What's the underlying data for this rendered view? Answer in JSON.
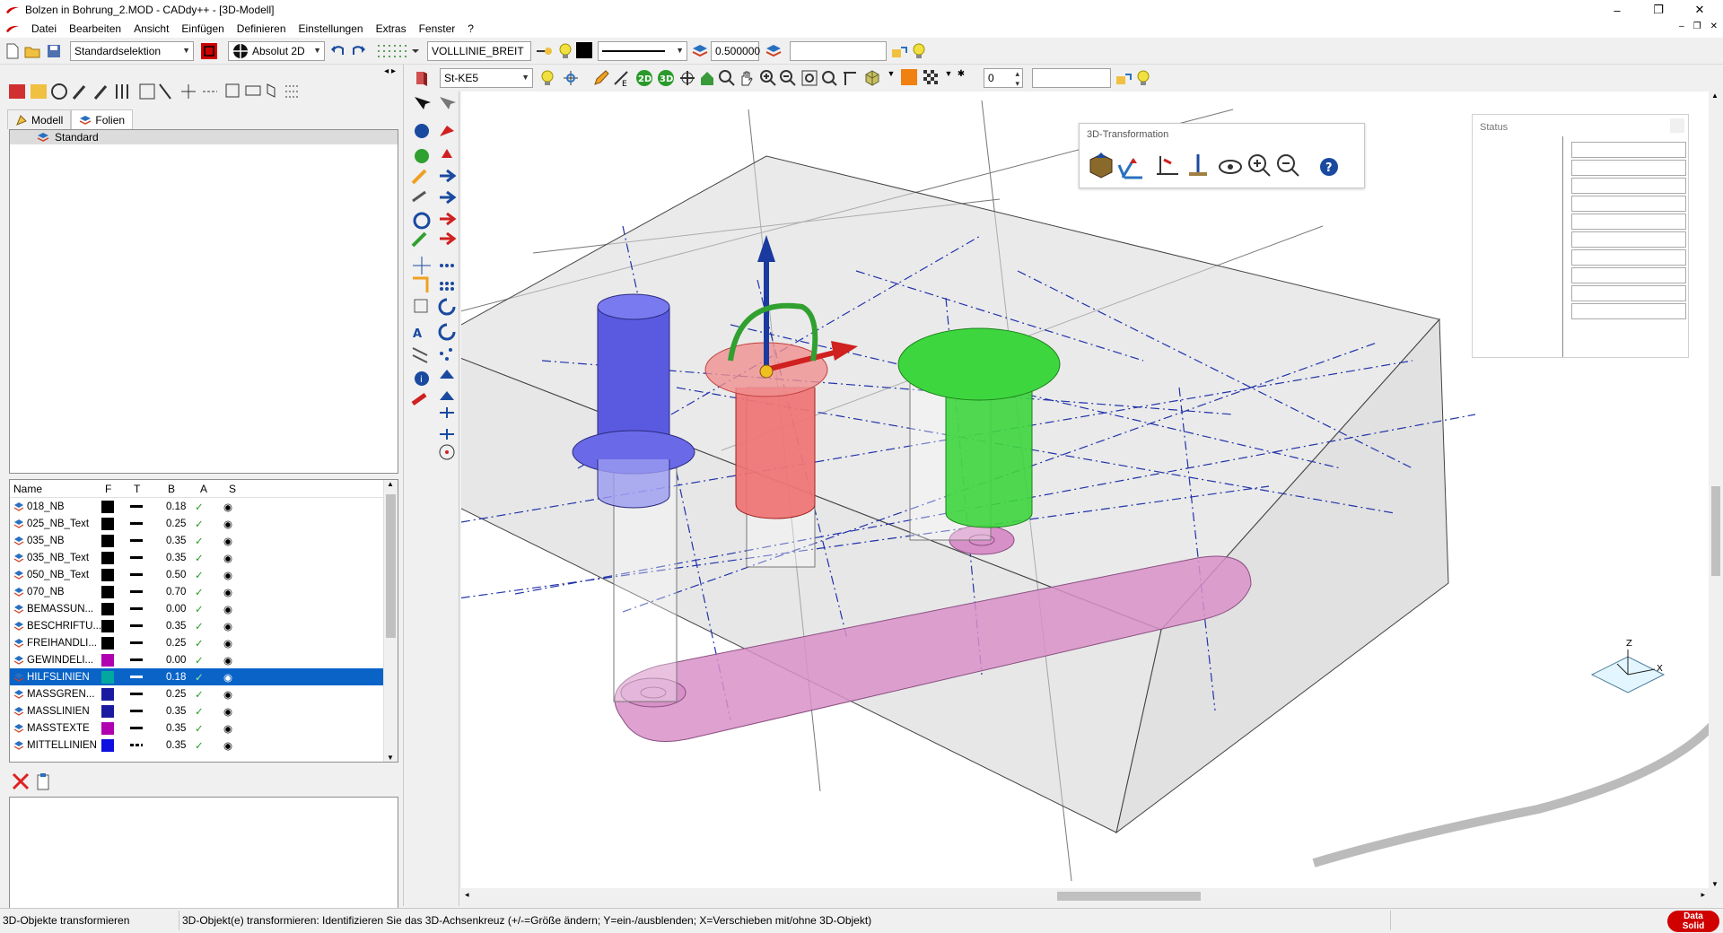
{
  "window": {
    "title": "Bolzen in Bohrung_2.MOD  -  CADdy++ - [3D-Modell]",
    "minimize": "–",
    "maximize": "❐",
    "close": "✕"
  },
  "menu": [
    "Datei",
    "Bearbeiten",
    "Ansicht",
    "Einfügen",
    "Definieren",
    "Einstellungen",
    "Extras",
    "Fenster",
    "?"
  ],
  "toolbar": {
    "selection_mode": "Standardselektion",
    "coord_mode": "Absolut 2D",
    "linetype": "VOLLLINIE_BREIT",
    "line_width": "0.500000",
    "layer_value": "",
    "material": "St-KE5",
    "count_value": "0",
    "view_value": ""
  },
  "tabs": [
    {
      "label": "Modell",
      "active": false
    },
    {
      "label": "Folien",
      "active": true
    }
  ],
  "folien": [
    "Standard"
  ],
  "layer_table": {
    "columns": [
      "Name",
      "F",
      "T",
      "B",
      "A",
      "S"
    ],
    "rows": [
      {
        "name": "018_NB",
        "color": "#000000",
        "width": "0.18",
        "selected": false,
        "dash": false
      },
      {
        "name": "025_NB_Text",
        "color": "#000000",
        "width": "0.25",
        "selected": false,
        "dash": false
      },
      {
        "name": "035_NB",
        "color": "#000000",
        "width": "0.35",
        "selected": false,
        "dash": false
      },
      {
        "name": "035_NB_Text",
        "color": "#000000",
        "width": "0.35",
        "selected": false,
        "dash": false
      },
      {
        "name": "050_NB_Text",
        "color": "#000000",
        "width": "0.50",
        "selected": false,
        "dash": false
      },
      {
        "name": "070_NB",
        "color": "#000000",
        "width": "0.70",
        "selected": false,
        "dash": false
      },
      {
        "name": "BEMASSUN...",
        "color": "#000000",
        "width": "0.00",
        "selected": false,
        "dash": false
      },
      {
        "name": "BESCHRIFTU...",
        "color": "#000000",
        "width": "0.35",
        "selected": false,
        "dash": false
      },
      {
        "name": "FREIHANDLI...",
        "color": "#000000",
        "width": "0.25",
        "selected": false,
        "dash": false
      },
      {
        "name": "GEWINDELI...",
        "color": "#b000b0",
        "width": "0.00",
        "selected": false,
        "dash": false
      },
      {
        "name": "HILFSLINIEN",
        "color": "#00a8a0",
        "width": "0.18",
        "selected": true,
        "dash": false
      },
      {
        "name": "MASSGREN...",
        "color": "#1a1aa0",
        "width": "0.25",
        "selected": false,
        "dash": false
      },
      {
        "name": "MASSLINIEN",
        "color": "#1a1aa0",
        "width": "0.35",
        "selected": false,
        "dash": false
      },
      {
        "name": "MASSTEXTE",
        "color": "#b000b0",
        "width": "0.35",
        "selected": false,
        "dash": false
      },
      {
        "name": "MITTELLINIEN",
        "color": "#1010e0",
        "width": "0.35",
        "selected": false,
        "dash": true
      }
    ]
  },
  "float_transform": {
    "title": "3D-Transformation"
  },
  "float_status": {
    "title": "Status"
  },
  "statusbar": {
    "left": "3D-Objekte transformieren",
    "message": "3D-Objekt(e) transformieren: Identifizieren Sie das 3D-Achsenkreuz (+/-=Größe ändern; Y=ein-/ausblenden; X=Verschieben mit/ohne 3D-Objekt)",
    "brand_line1": "Data",
    "brand_line2": "Solid"
  },
  "colors": {
    "accent": "#0a64c8",
    "hidden_line": "#2233aa",
    "blue_part": "#5a5ae0",
    "red_part": "#f07070",
    "green_part": "#3ed63e",
    "pink_part": "#d890c8"
  }
}
